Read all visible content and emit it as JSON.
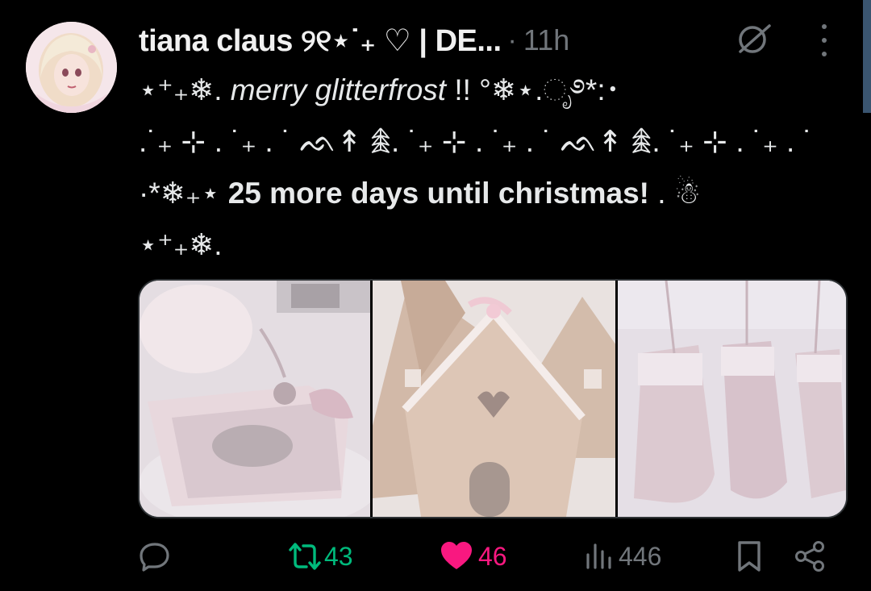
{
  "tweet": {
    "author_name": "tiana claus ୨୧⋆˙₊ ♡ | DE...",
    "separator": "·",
    "time": "11h",
    "lines": [
      {
        "sym_before": "⋆⁺₊❄︎. ",
        "italic": "merry glitterfrost",
        "sym_after": " !! °❄︎⋆.ೃ࿔*:･"
      },
      {
        "sym": ".˙₊ ⊹ . ˙₊ . ˙ ᨒ↟ 𖠰. ˙₊ ⊹ . ˙₊ . ˙ ᨒ↟ 𖠰. ˙₊ ⊹ . ˙₊ . ˙"
      },
      {
        "sym_before": "·*❄︎₊⋆ ",
        "bold": "25 more days until christmas!",
        "sym_after": " . ☃︎"
      },
      {
        "sym": "⋆⁺₊❄︎."
      }
    ]
  },
  "actions": {
    "reply_count": "",
    "retweet_count": "43",
    "like_count": "46",
    "views_count": "446"
  },
  "colors": {
    "retweet": "#00ba7c",
    "like": "#f91880",
    "muted": "#71767b"
  },
  "icons": [
    "avatar",
    "grok-icon",
    "more-icon",
    "reply-icon",
    "retweet-icon",
    "heart-icon",
    "views-icon",
    "bookmark-icon",
    "share-icon"
  ]
}
